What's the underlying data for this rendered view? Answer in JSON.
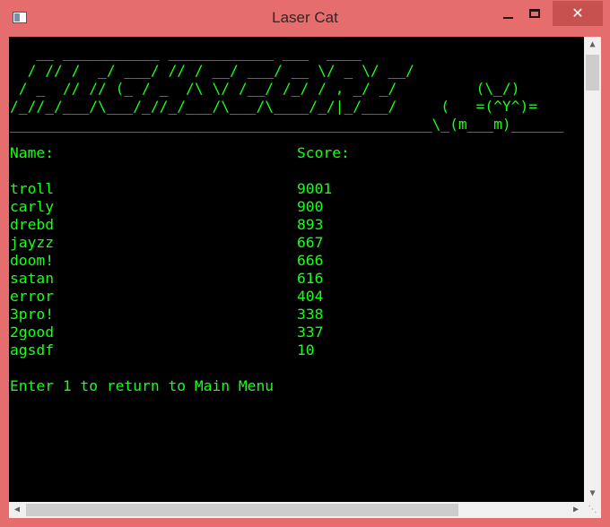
{
  "window": {
    "title": "Laser Cat",
    "close_glyph": "✕"
  },
  "banner": {
    "lines": [
      "   __ ___________ ____________ ___  ____",
      "  / // /  _/ ___/ // / __/ ___/ __ \\/ _ \\/ __/",
      " / _  // // (_ / _  /\\ \\/ /__/ /_/ / , _/ _/         (\\_/)",
      "/_//_/___/\\___/_//_/___/\\___/\\____/_/|_/___/     (   =(^Y^)=",
      "________________________________________________\\_(m___m)______"
    ]
  },
  "table": {
    "name_header": "Name:",
    "score_header": "Score:",
    "rows": [
      {
        "name": "troll",
        "score": "9001"
      },
      {
        "name": "carly",
        "score": "900"
      },
      {
        "name": "drebd",
        "score": "893"
      },
      {
        "name": "jayzz",
        "score": "667"
      },
      {
        "name": "doom!",
        "score": "666"
      },
      {
        "name": "satan",
        "score": "616"
      },
      {
        "name": "error",
        "score": "404"
      },
      {
        "name": "3pro!",
        "score": "338"
      },
      {
        "name": "2good",
        "score": "337"
      },
      {
        "name": "agsdf",
        "score": "10"
      }
    ]
  },
  "prompt": "Enter 1 to return to Main Menu",
  "colors": {
    "console_text": "#18ff18",
    "console_bg": "#000000",
    "window_frame": "#e56d6d",
    "close_button": "#c7514f"
  }
}
